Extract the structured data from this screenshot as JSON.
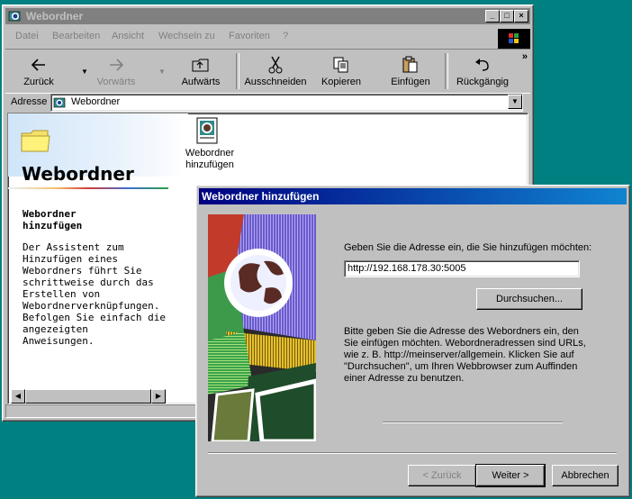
{
  "explorer": {
    "title": "Webordner",
    "menu": [
      {
        "label": "Datei"
      },
      {
        "label": "Bearbeiten"
      },
      {
        "label": "Ansicht"
      },
      {
        "label": "Wechseln zu"
      },
      {
        "label": "Favoriten"
      },
      {
        "label": "?"
      }
    ],
    "toolbar": {
      "back": "Zurück",
      "forward": "Vorwärts",
      "up": "Aufwärts",
      "cut": "Ausschneiden",
      "copy": "Kopieren",
      "paste": "Einfügen",
      "undo": "Rückgängig",
      "more": "»"
    },
    "address": {
      "label": "Adresse",
      "value": "Webordner"
    },
    "info_panel": {
      "heading": "Webordner",
      "subheading": "Webordner\nhinzufügen",
      "description": "Der Assistent zum\nHinzufügen eines\nWebordners führt Sie\nschrittweise durch das\nErstellen von\nWebordnerverknüpfungen.\nBefolgen Sie einfach die\nangezeigten\nAnweisungen."
    },
    "item": {
      "label": "Webordner\nhinzufügen"
    }
  },
  "dialog": {
    "title": "Webordner hinzufügen",
    "prompt": "Geben Sie die Adresse ein, die Sie hinzufügen möchten:",
    "url_value": "http://192.168.178.30:5005",
    "browse_button": "Durchsuchen...",
    "help_text": "Bitte geben Sie die Adresse des Webordners ein, den Sie einfügen möchten. Webordneradressen sind URLs, wie z. B. http://meinserver/allgemein.  Klicken Sie auf \"Durchsuchen\", um Ihren Webbrowser zum Auffinden einer Adresse zu benutzen.",
    "back_button": "< Zurück",
    "next_button": "Weiter >",
    "cancel_button": "Abbrechen"
  },
  "colors": {
    "desktop": "#008080",
    "inactive_title": "#808080",
    "active_title_start": "#000080",
    "active_title_end": "#1084d0"
  }
}
